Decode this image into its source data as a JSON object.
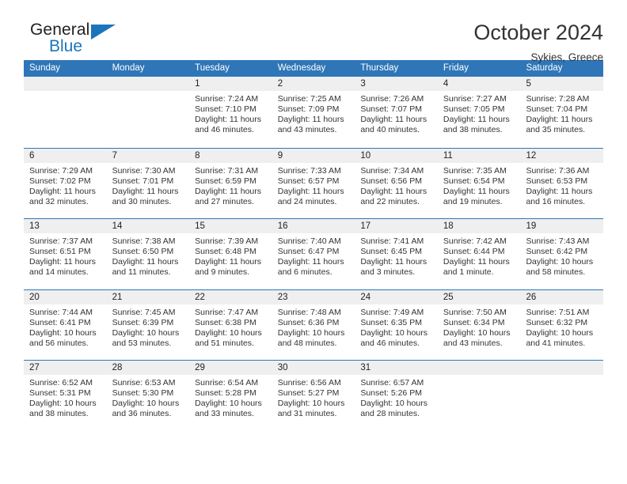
{
  "brand": {
    "name_top": "General",
    "name_bottom": "Blue",
    "accent_color": "#1b75bb",
    "triangle_icon": "triangle-right-icon"
  },
  "header": {
    "title": "October 2024",
    "location": "Sykies, Greece"
  },
  "calendar": {
    "header_color": "#2e76b8",
    "daynum_band_color": "#efefef",
    "weekday_names": [
      "Sunday",
      "Monday",
      "Tuesday",
      "Wednesday",
      "Thursday",
      "Friday",
      "Saturday"
    ],
    "weeks": [
      [
        {
          "day": "",
          "lines": []
        },
        {
          "day": "",
          "lines": []
        },
        {
          "day": "1",
          "lines": [
            "Sunrise: 7:24 AM",
            "Sunset: 7:10 PM",
            "Daylight: 11 hours",
            "and 46 minutes."
          ]
        },
        {
          "day": "2",
          "lines": [
            "Sunrise: 7:25 AM",
            "Sunset: 7:09 PM",
            "Daylight: 11 hours",
            "and 43 minutes."
          ]
        },
        {
          "day": "3",
          "lines": [
            "Sunrise: 7:26 AM",
            "Sunset: 7:07 PM",
            "Daylight: 11 hours",
            "and 40 minutes."
          ]
        },
        {
          "day": "4",
          "lines": [
            "Sunrise: 7:27 AM",
            "Sunset: 7:05 PM",
            "Daylight: 11 hours",
            "and 38 minutes."
          ]
        },
        {
          "day": "5",
          "lines": [
            "Sunrise: 7:28 AM",
            "Sunset: 7:04 PM",
            "Daylight: 11 hours",
            "and 35 minutes."
          ]
        }
      ],
      [
        {
          "day": "6",
          "lines": [
            "Sunrise: 7:29 AM",
            "Sunset: 7:02 PM",
            "Daylight: 11 hours",
            "and 32 minutes."
          ]
        },
        {
          "day": "7",
          "lines": [
            "Sunrise: 7:30 AM",
            "Sunset: 7:01 PM",
            "Daylight: 11 hours",
            "and 30 minutes."
          ]
        },
        {
          "day": "8",
          "lines": [
            "Sunrise: 7:31 AM",
            "Sunset: 6:59 PM",
            "Daylight: 11 hours",
            "and 27 minutes."
          ]
        },
        {
          "day": "9",
          "lines": [
            "Sunrise: 7:33 AM",
            "Sunset: 6:57 PM",
            "Daylight: 11 hours",
            "and 24 minutes."
          ]
        },
        {
          "day": "10",
          "lines": [
            "Sunrise: 7:34 AM",
            "Sunset: 6:56 PM",
            "Daylight: 11 hours",
            "and 22 minutes."
          ]
        },
        {
          "day": "11",
          "lines": [
            "Sunrise: 7:35 AM",
            "Sunset: 6:54 PM",
            "Daylight: 11 hours",
            "and 19 minutes."
          ]
        },
        {
          "day": "12",
          "lines": [
            "Sunrise: 7:36 AM",
            "Sunset: 6:53 PM",
            "Daylight: 11 hours",
            "and 16 minutes."
          ]
        }
      ],
      [
        {
          "day": "13",
          "lines": [
            "Sunrise: 7:37 AM",
            "Sunset: 6:51 PM",
            "Daylight: 11 hours",
            "and 14 minutes."
          ]
        },
        {
          "day": "14",
          "lines": [
            "Sunrise: 7:38 AM",
            "Sunset: 6:50 PM",
            "Daylight: 11 hours",
            "and 11 minutes."
          ]
        },
        {
          "day": "15",
          "lines": [
            "Sunrise: 7:39 AM",
            "Sunset: 6:48 PM",
            "Daylight: 11 hours",
            "and 9 minutes."
          ]
        },
        {
          "day": "16",
          "lines": [
            "Sunrise: 7:40 AM",
            "Sunset: 6:47 PM",
            "Daylight: 11 hours",
            "and 6 minutes."
          ]
        },
        {
          "day": "17",
          "lines": [
            "Sunrise: 7:41 AM",
            "Sunset: 6:45 PM",
            "Daylight: 11 hours",
            "and 3 minutes."
          ]
        },
        {
          "day": "18",
          "lines": [
            "Sunrise: 7:42 AM",
            "Sunset: 6:44 PM",
            "Daylight: 11 hours",
            "and 1 minute."
          ]
        },
        {
          "day": "19",
          "lines": [
            "Sunrise: 7:43 AM",
            "Sunset: 6:42 PM",
            "Daylight: 10 hours",
            "and 58 minutes."
          ]
        }
      ],
      [
        {
          "day": "20",
          "lines": [
            "Sunrise: 7:44 AM",
            "Sunset: 6:41 PM",
            "Daylight: 10 hours",
            "and 56 minutes."
          ]
        },
        {
          "day": "21",
          "lines": [
            "Sunrise: 7:45 AM",
            "Sunset: 6:39 PM",
            "Daylight: 10 hours",
            "and 53 minutes."
          ]
        },
        {
          "day": "22",
          "lines": [
            "Sunrise: 7:47 AM",
            "Sunset: 6:38 PM",
            "Daylight: 10 hours",
            "and 51 minutes."
          ]
        },
        {
          "day": "23",
          "lines": [
            "Sunrise: 7:48 AM",
            "Sunset: 6:36 PM",
            "Daylight: 10 hours",
            "and 48 minutes."
          ]
        },
        {
          "day": "24",
          "lines": [
            "Sunrise: 7:49 AM",
            "Sunset: 6:35 PM",
            "Daylight: 10 hours",
            "and 46 minutes."
          ]
        },
        {
          "day": "25",
          "lines": [
            "Sunrise: 7:50 AM",
            "Sunset: 6:34 PM",
            "Daylight: 10 hours",
            "and 43 minutes."
          ]
        },
        {
          "day": "26",
          "lines": [
            "Sunrise: 7:51 AM",
            "Sunset: 6:32 PM",
            "Daylight: 10 hours",
            "and 41 minutes."
          ]
        }
      ],
      [
        {
          "day": "27",
          "lines": [
            "Sunrise: 6:52 AM",
            "Sunset: 5:31 PM",
            "Daylight: 10 hours",
            "and 38 minutes."
          ]
        },
        {
          "day": "28",
          "lines": [
            "Sunrise: 6:53 AM",
            "Sunset: 5:30 PM",
            "Daylight: 10 hours",
            "and 36 minutes."
          ]
        },
        {
          "day": "29",
          "lines": [
            "Sunrise: 6:54 AM",
            "Sunset: 5:28 PM",
            "Daylight: 10 hours",
            "and 33 minutes."
          ]
        },
        {
          "day": "30",
          "lines": [
            "Sunrise: 6:56 AM",
            "Sunset: 5:27 PM",
            "Daylight: 10 hours",
            "and 31 minutes."
          ]
        },
        {
          "day": "31",
          "lines": [
            "Sunrise: 6:57 AM",
            "Sunset: 5:26 PM",
            "Daylight: 10 hours",
            "and 28 minutes."
          ]
        },
        {
          "day": "",
          "lines": []
        },
        {
          "day": "",
          "lines": []
        }
      ]
    ]
  }
}
